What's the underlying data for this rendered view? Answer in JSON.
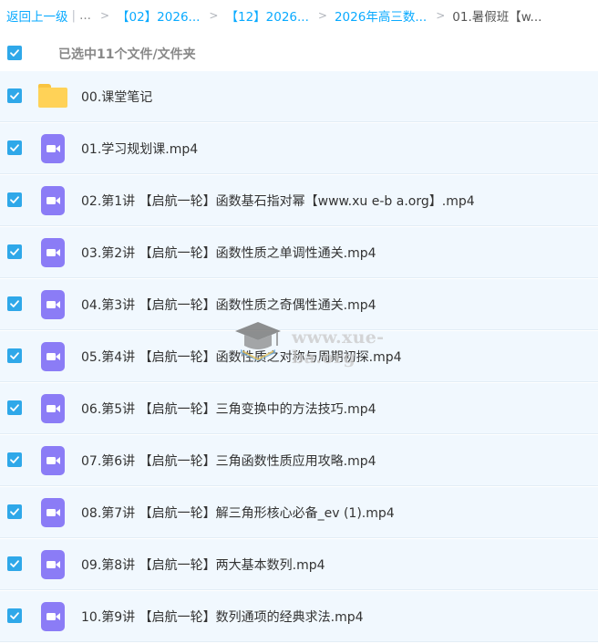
{
  "breadcrumb": {
    "back": "返回上一级",
    "separator": "|",
    "ellipsis": "...",
    "arrow": ">",
    "items": [
      "【02】2026...",
      "【12】2026...",
      "2026年高三数..."
    ],
    "current": "01.暑假班【w..."
  },
  "selection": {
    "text": "已选中11个文件/文件夹",
    "checked": true
  },
  "files": [
    {
      "name": "00.课堂笔记",
      "type": "folder",
      "checked": true
    },
    {
      "name": "01.学习规划课.mp4",
      "type": "video",
      "checked": true
    },
    {
      "name": "02.第1讲 【启航一轮】函数基石指对幂【www.xu e-b a.org】.mp4",
      "type": "video",
      "checked": true
    },
    {
      "name": "03.第2讲 【启航一轮】函数性质之单调性通关.mp4",
      "type": "video",
      "checked": true
    },
    {
      "name": "04.第3讲 【启航一轮】函数性质之奇偶性通关.mp4",
      "type": "video",
      "checked": true
    },
    {
      "name": "05.第4讲 【启航一轮】函数性质之对称与周期初探.mp4",
      "type": "video",
      "checked": true
    },
    {
      "name": "06.第5讲 【启航一轮】三角变换中的方法技巧.mp4",
      "type": "video",
      "checked": true
    },
    {
      "name": "07.第6讲 【启航一轮】三角函数性质应用攻略.mp4",
      "type": "video",
      "checked": true
    },
    {
      "name": "08.第7讲 【启航一轮】解三角形核心必备_ev (1).mp4",
      "type": "video",
      "checked": true
    },
    {
      "name": "09.第8讲 【启航一轮】两大基本数列.mp4",
      "type": "video",
      "checked": true
    },
    {
      "name": "10.第9讲 【启航一轮】数列通项的经典求法.mp4",
      "type": "video",
      "checked": true
    }
  ],
  "watermark": {
    "text": "www.xue-ba.org"
  },
  "colors": {
    "accent": "#09aaff",
    "checkbox": "#2fa8e9",
    "row_bg": "#f1f8fe",
    "video_icon": "#8b7cf6",
    "folder_icon": "#ffd257"
  }
}
